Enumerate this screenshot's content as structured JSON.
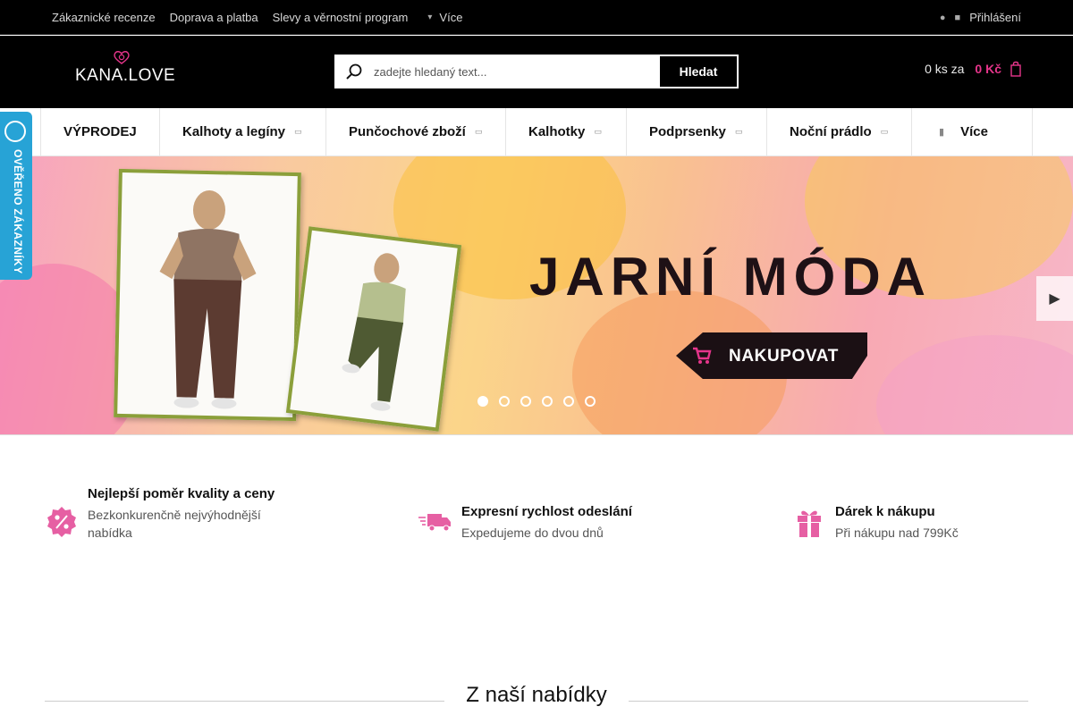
{
  "topbar": {
    "links": [
      "Zákaznické recenze",
      "Doprava a platba",
      "Slevy a věrnostní program"
    ],
    "more_label": "Více",
    "login_label": "Přihlášení"
  },
  "header": {
    "logo_text": "KANA.LOVE",
    "search_placeholder": "zadejte hledaný text...",
    "search_button": "Hledat",
    "cart_count": "0 ks za",
    "cart_price": "0 Kč"
  },
  "nav": {
    "items": [
      {
        "label": "VÝPRODEJ",
        "has_dropdown": false
      },
      {
        "label": "Kalhoty a legíny",
        "has_dropdown": true
      },
      {
        "label": "Punčochové zboží",
        "has_dropdown": true
      },
      {
        "label": "Kalhotky",
        "has_dropdown": true
      },
      {
        "label": "Podprsenky",
        "has_dropdown": true
      },
      {
        "label": "Noční prádlo",
        "has_dropdown": true
      }
    ],
    "more_label": "Více"
  },
  "badge": {
    "text": "OVĚŘENO ZÁKAZNÍKY"
  },
  "banner": {
    "headline": "JARNÍ MÓDA",
    "cta": "NAKUPOVAT",
    "slides": 6,
    "active_slide": 1
  },
  "usps": [
    {
      "title": "Nejlepší poměr kvality a ceny",
      "subtitle": "Bezkonkurenčně nejvýhodnější nabídka",
      "icon": "percent-icon"
    },
    {
      "title": "Expresní rychlost odeslání",
      "subtitle": "Expedujeme do dvou dnů",
      "icon": "truck-icon"
    },
    {
      "title": "Dárek k nákupu",
      "subtitle": "Při nákupu nad 799Kč",
      "icon": "gift-icon"
    }
  ],
  "section": {
    "title": "Z naší nabídky"
  },
  "colors": {
    "accent": "#e6358b",
    "badge": "#27a3d6",
    "photo_frame": "#8b9f3a"
  }
}
